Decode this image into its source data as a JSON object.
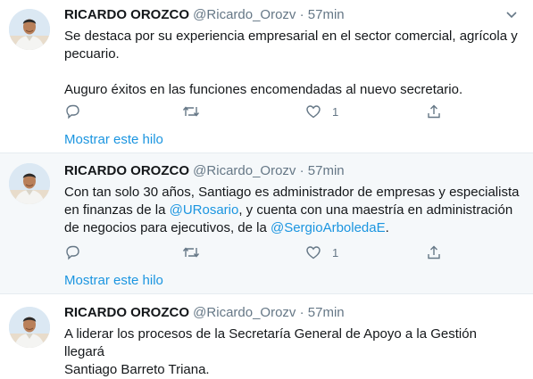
{
  "tweets": [
    {
      "name": "RICARDO OROZCO",
      "handle": "@Ricardo_Orozv",
      "sep": "·",
      "time": "57min",
      "text_lines": [
        "Se destaca por su experiencia empresarial en el sector comercial, agrícola y",
        "pecuario."
      ],
      "text2": "Auguro éxitos en las funciones encomendadas al nuevo secretario.",
      "like_count": "1",
      "thread_label": "Mostrar este hilo"
    },
    {
      "name": "RICARDO OROZCO",
      "handle": "@Ricardo_Orozv",
      "sep": "·",
      "time": "57min",
      "line1": "Con tan solo 30 años, Santiago es administrador de empresas y especialista",
      "line2_a": "en finanzas de la ",
      "mention1": "@URosario",
      "line2_b": ", y cuenta con una maestría en administración",
      "line3_a": "de negocios para ejecutivos, de la ",
      "mention2": "@SergioArboledaE",
      "line3_b": ".",
      "like_count": "1",
      "thread_label": "Mostrar este hilo"
    },
    {
      "name": "RICARDO OROZCO",
      "handle": "@Ricardo_Orozv",
      "sep": "·",
      "time": "57min",
      "text_lines": [
        "A liderar los procesos de la Secretaría General de Apoyo a la Gestión llegará",
        "Santiago Barreto Triana."
      ]
    }
  ],
  "icons": {
    "reply": "reply-icon",
    "retweet": "retweet-icon",
    "like": "heart-icon",
    "share": "share-icon",
    "more": "chevron-down-icon"
  },
  "colors": {
    "link": "#1b95e0",
    "meta": "#657786",
    "alt_background": "#f5f8fa"
  }
}
